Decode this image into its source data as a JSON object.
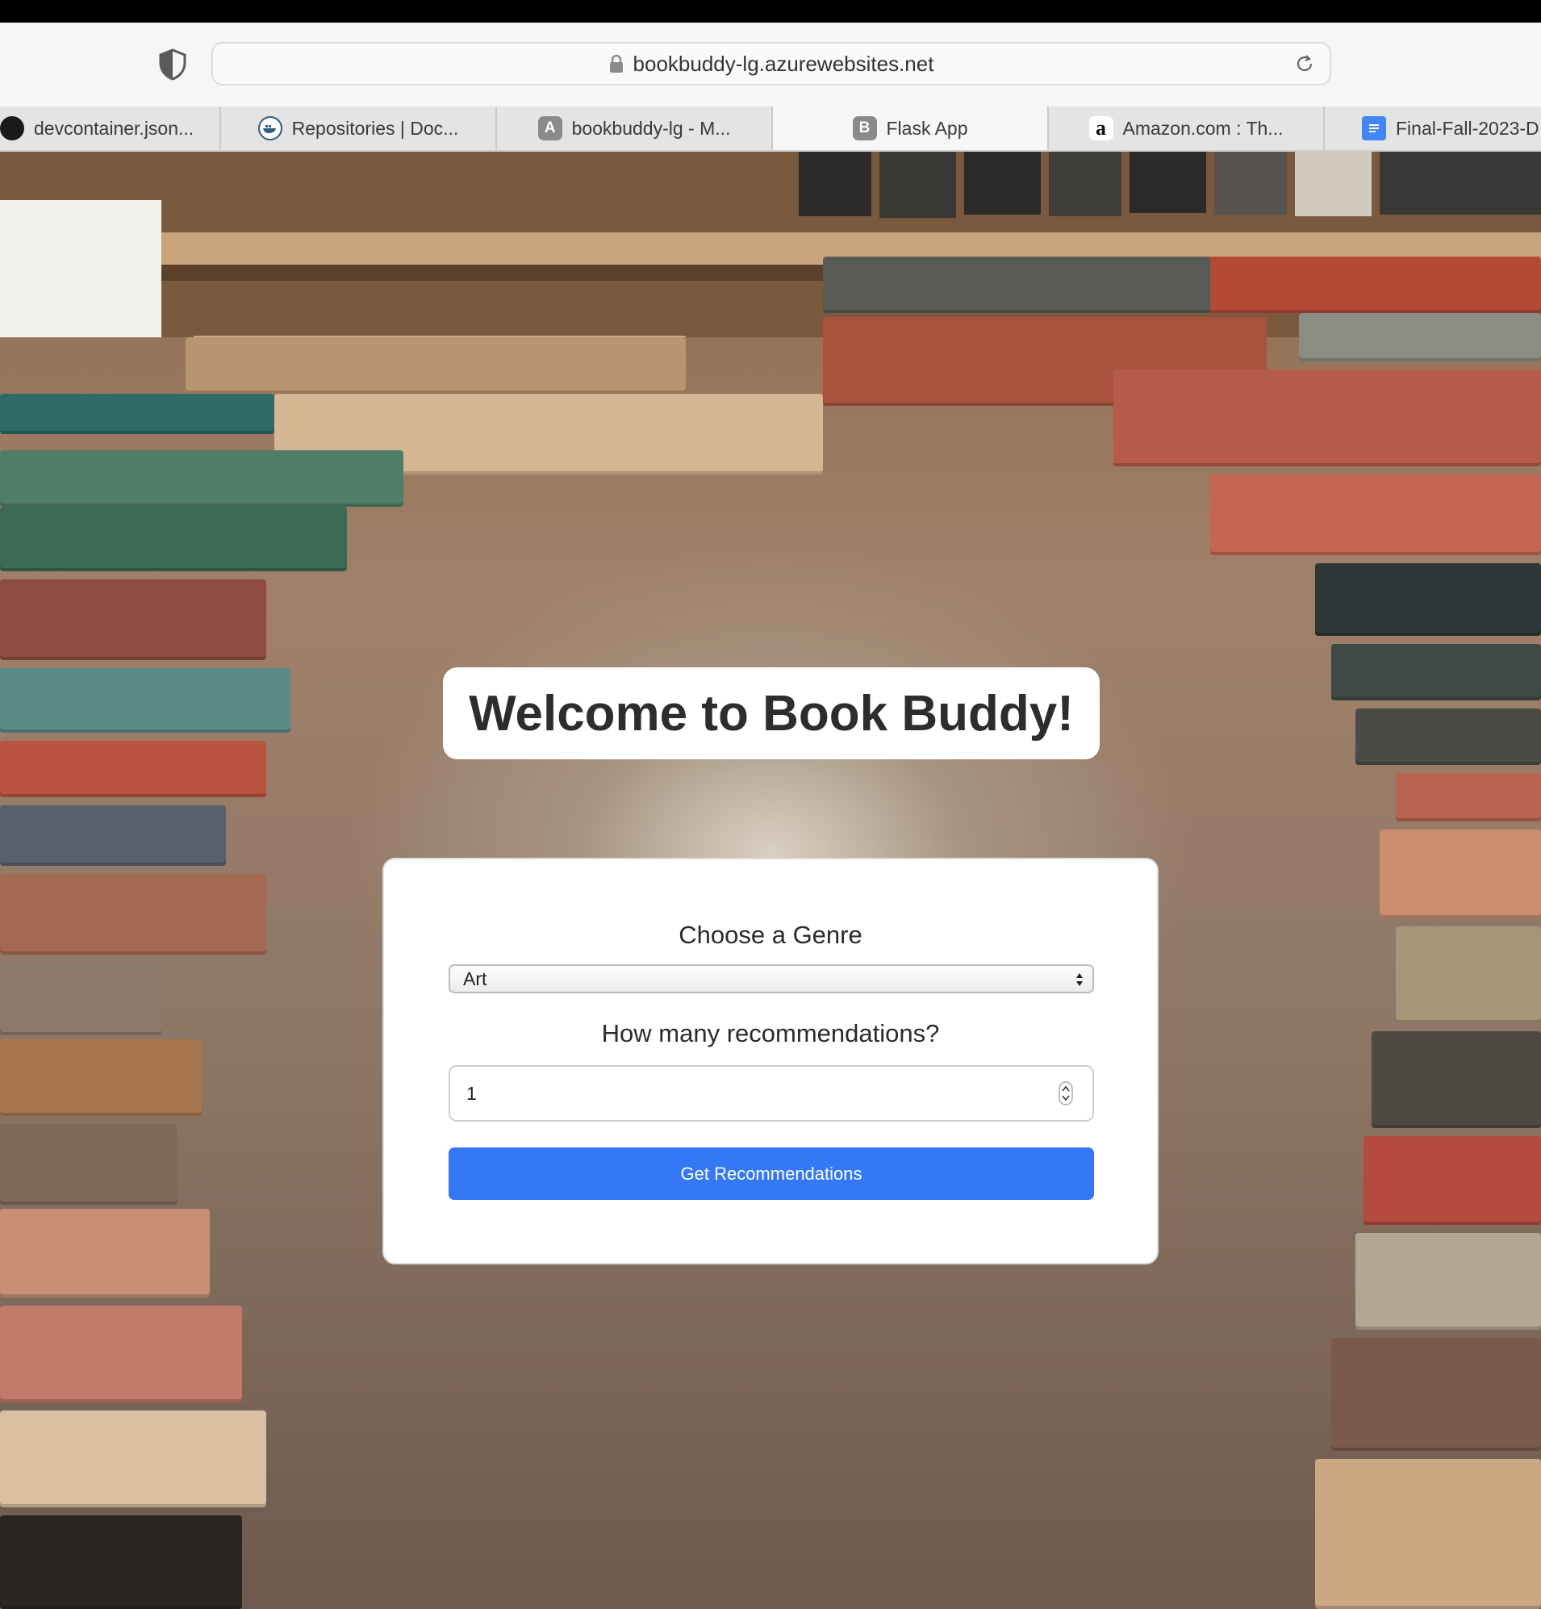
{
  "browser": {
    "url": "bookbuddy-lg.azurewebsites.net",
    "tabs": [
      {
        "label": "devcontainer.json...",
        "icon": "github-icon",
        "active": false
      },
      {
        "label": "Repositories | Doc...",
        "icon": "docker-icon",
        "active": false
      },
      {
        "label": "bookbuddy-lg - M...",
        "icon": "letter-a-icon",
        "icon_letter": "A",
        "active": false
      },
      {
        "label": "Flask App",
        "icon": "letter-b-icon",
        "icon_letter": "B",
        "active": true
      },
      {
        "label": "Amazon.com : Th...",
        "icon": "amazon-icon",
        "icon_letter": "a",
        "active": false
      },
      {
        "label": "Final-Fall-2023-D",
        "icon": "google-docs-icon",
        "active": false
      }
    ]
  },
  "page": {
    "title": "Welcome to Book Buddy!",
    "form": {
      "genre_label": "Choose a Genre",
      "genre_value": "Art",
      "count_label": "How many recommendations?",
      "count_value": "1",
      "submit_label": "Get Recommendations"
    }
  },
  "colors": {
    "accent": "#3478f6"
  }
}
